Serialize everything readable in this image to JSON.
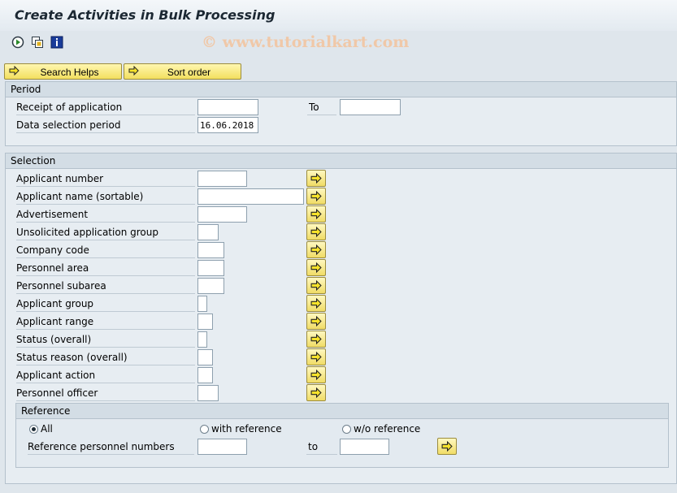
{
  "window": {
    "title": "Create Activities in Bulk Processing"
  },
  "toolbar": {
    "icons": [
      "execute-icon",
      "copy-variant-icon",
      "info-icon"
    ],
    "watermark": "© www.tutorialkart.com"
  },
  "buttons": {
    "search_helps": "Search Helps",
    "sort_order": "Sort order"
  },
  "period": {
    "title": "Period",
    "receipt_label": "Receipt of application",
    "to_label": "To",
    "receipt_from": "",
    "receipt_to": "",
    "data_selection_label": "Data selection period",
    "data_selection_value": "16.06.2018"
  },
  "selection": {
    "title": "Selection",
    "fields": [
      {
        "label": "Applicant number",
        "value": ""
      },
      {
        "label": "Applicant name (sortable)",
        "value": ""
      },
      {
        "label": "Advertisement",
        "value": ""
      },
      {
        "label": "Unsolicited application group",
        "value": ""
      },
      {
        "label": "Company code",
        "value": ""
      },
      {
        "label": "Personnel area",
        "value": ""
      },
      {
        "label": "Personnel subarea",
        "value": ""
      },
      {
        "label": "Applicant group",
        "value": ""
      },
      {
        "label": "Applicant range",
        "value": ""
      },
      {
        "label": "Status (overall)",
        "value": ""
      },
      {
        "label": "Status reason (overall)",
        "value": ""
      },
      {
        "label": "Applicant action",
        "value": ""
      },
      {
        "label": "Personnel officer",
        "value": ""
      }
    ]
  },
  "reference": {
    "title": "Reference",
    "options": [
      {
        "label": "All",
        "selected": true
      },
      {
        "label": "with reference",
        "selected": false
      },
      {
        "label": "w/o reference",
        "selected": false
      }
    ],
    "numbers_label": "Reference personnel numbers",
    "to_label": "to",
    "from_value": "",
    "to_value": ""
  }
}
